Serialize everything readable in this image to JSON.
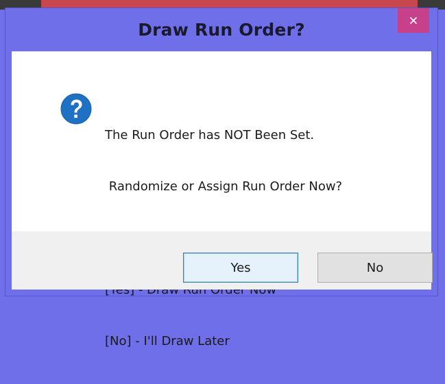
{
  "dialog": {
    "title": "Draw Run Order?",
    "close_symbol": "×",
    "message_lines": [
      "The Run Order has NOT Been Set.",
      " Randomize or Assign Run Order Now?",
      "[Yes] - Draw Run Order Now",
      "[No] - I'll Draw Later"
    ],
    "icon": "question-icon",
    "buttons": {
      "yes_label": "Yes",
      "no_label": "No"
    }
  },
  "colors": {
    "titlebar": "#6e6fe9",
    "close_button": "#c7408c",
    "icon_blue": "#1f71c4",
    "footer": "#f0f0f0"
  }
}
